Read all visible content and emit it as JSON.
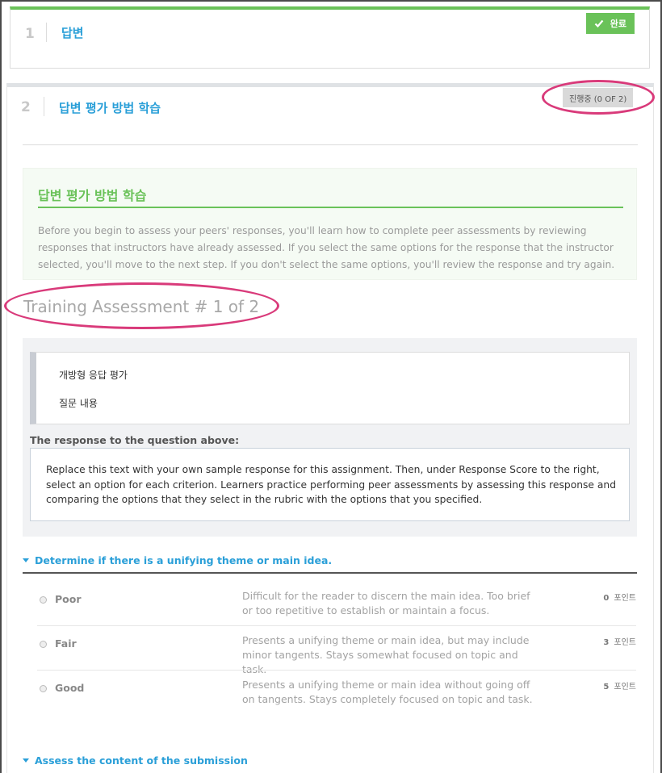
{
  "step1": {
    "number": "1",
    "title": "답변",
    "status": "완료"
  },
  "step2": {
    "number": "2",
    "title": "답변 평가 방법 학습",
    "status": "진행중 (0 OF 2)"
  },
  "instructions": {
    "title": "답변 평가 방법 학습",
    "text": "Before you begin to assess your peers' responses, you'll learn how to complete peer assessments by reviewing responses that instructors have already assessed. If you select the same options for the response that the instructor selected, you'll move to the next step. If you don't select the same options, you'll review the response and try again."
  },
  "training": {
    "heading": "Training Assessment # 1 of 2",
    "question_title": "개방형 응답 평가",
    "question_body": "질문 내용",
    "response_label": "The response to the question above:",
    "response_text": "Replace this text with your own sample response for this assignment. Then, under Response Score to the right, select an option for each criterion. Learners practice performing peer assessments by assessing this response and comparing the options that they select in the rubric with the options that you specified."
  },
  "criteria": [
    {
      "title": "Determine if there is a unifying theme or main idea.",
      "options": [
        {
          "name": "Poor",
          "description": "Difficult for the reader to discern the main idea.  Too brief or too repetitive to establish or maintain a focus.",
          "points": "0",
          "points_unit": "포인트"
        },
        {
          "name": "Fair",
          "description": "Presents a unifying theme or main idea, but may include minor tangents.  Stays somewhat focused on topic and task.",
          "points": "3",
          "points_unit": "포인트"
        },
        {
          "name": "Good",
          "description": "Presents a unifying theme or main idea without going off on tangents.  Stays completely focused on topic and task.",
          "points": "5",
          "points_unit": "포인트"
        }
      ]
    },
    {
      "title": "Assess the content of the submission"
    }
  ],
  "colors": {
    "accent_green": "#6ac259",
    "link_blue": "#2a9fd8",
    "highlight_ring": "#d93a7a"
  }
}
